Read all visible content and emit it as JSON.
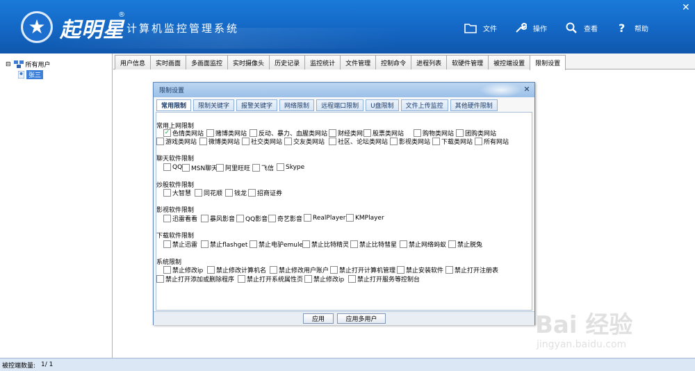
{
  "app": {
    "brand": "起明星",
    "reg_mark": "®",
    "title": "计算机监控管理系统",
    "window_close": "✕"
  },
  "header_buttons": [
    {
      "label": "文件",
      "icon": "folder-icon"
    },
    {
      "label": "操作",
      "icon": "wrench-icon"
    },
    {
      "label": "查看",
      "icon": "search-icon"
    },
    {
      "label": "帮助",
      "icon": "help-icon"
    }
  ],
  "tree": {
    "root_label": "所有用户",
    "child_label": "张三",
    "expander": "⊟"
  },
  "main_tabs": [
    "用户信息",
    "实时画面",
    "多画面监控",
    "实时摄像头",
    "历史记录",
    "监控统计",
    "文件管理",
    "控制命令",
    "进程列表",
    "软硬件管理",
    "被控端设置",
    "限制设置"
  ],
  "main_tab_active": "限制设置",
  "dialog": {
    "title": "限制设置",
    "close": "✕",
    "tabs": [
      "常用限制",
      "限制关键字",
      "报警关键字",
      "网络限制",
      "远程端口限制",
      "U盘限制",
      "文件上传监控",
      "其他硬件限制"
    ],
    "active_tab": "常用限制",
    "sections": {
      "web": {
        "title": "常用上网限制",
        "row1": [
          "色情类网站",
          "赌博类网站",
          "反动、暴力、血腥类网站",
          "财经类网站",
          "股票类网站",
          "购物类网站",
          "团购类网站"
        ],
        "row2": [
          "游戏类网站",
          "微博类网站",
          "社交类网站",
          "交友类网站",
          "社区、论坛类网站",
          "影视类网站",
          "下载类网站",
          "所有网站"
        ]
      },
      "chat": {
        "title": "聊天软件限制",
        "row1": [
          "QQ",
          "MSN聊天",
          "阿里旺旺",
          "飞信",
          "Skype"
        ]
      },
      "stock": {
        "title": "炒股软件限制",
        "row1": [
          "大智慧",
          "同花顺",
          "钱龙",
          "招商证券"
        ]
      },
      "video": {
        "title": "影视软件限制",
        "row1": [
          "迅雷看看",
          "暴风影音",
          "QQ影音",
          "奇艺影音",
          "RealPlayer",
          "KMPlayer"
        ]
      },
      "download": {
        "title": "下载软件限制",
        "row1": [
          "禁止迅雷",
          "禁止flashget",
          "禁止电驴emule",
          "禁止比特精灵",
          "禁止比特彗星",
          "禁止网络蚂蚁",
          "禁止脱兔"
        ]
      },
      "system": {
        "title": "系统限制",
        "row1": [
          "禁止修改ip",
          "禁止修改计算机名",
          "禁止修改用户账户",
          "禁止打开计算机管理",
          "禁止安装软件",
          "禁止打开注册表"
        ],
        "row2": [
          "禁止打开添加或删除程序",
          "禁止打开系统属性页",
          "禁止修改ip",
          "禁止打开服务等控制台"
        ]
      }
    },
    "checked_item": "色情类网站",
    "apply": "应用",
    "apply_multi": "应用多用户"
  },
  "status": {
    "label": "被控端数量:",
    "value": "1/ 1"
  },
  "watermark": {
    "line1": "Bai 经验",
    "line2": "jingyan.baidu.com"
  },
  "colors": {
    "header_bg": "#1467c4",
    "dialog_title": "#9cc0e8",
    "check_color": "#2a5"
  }
}
